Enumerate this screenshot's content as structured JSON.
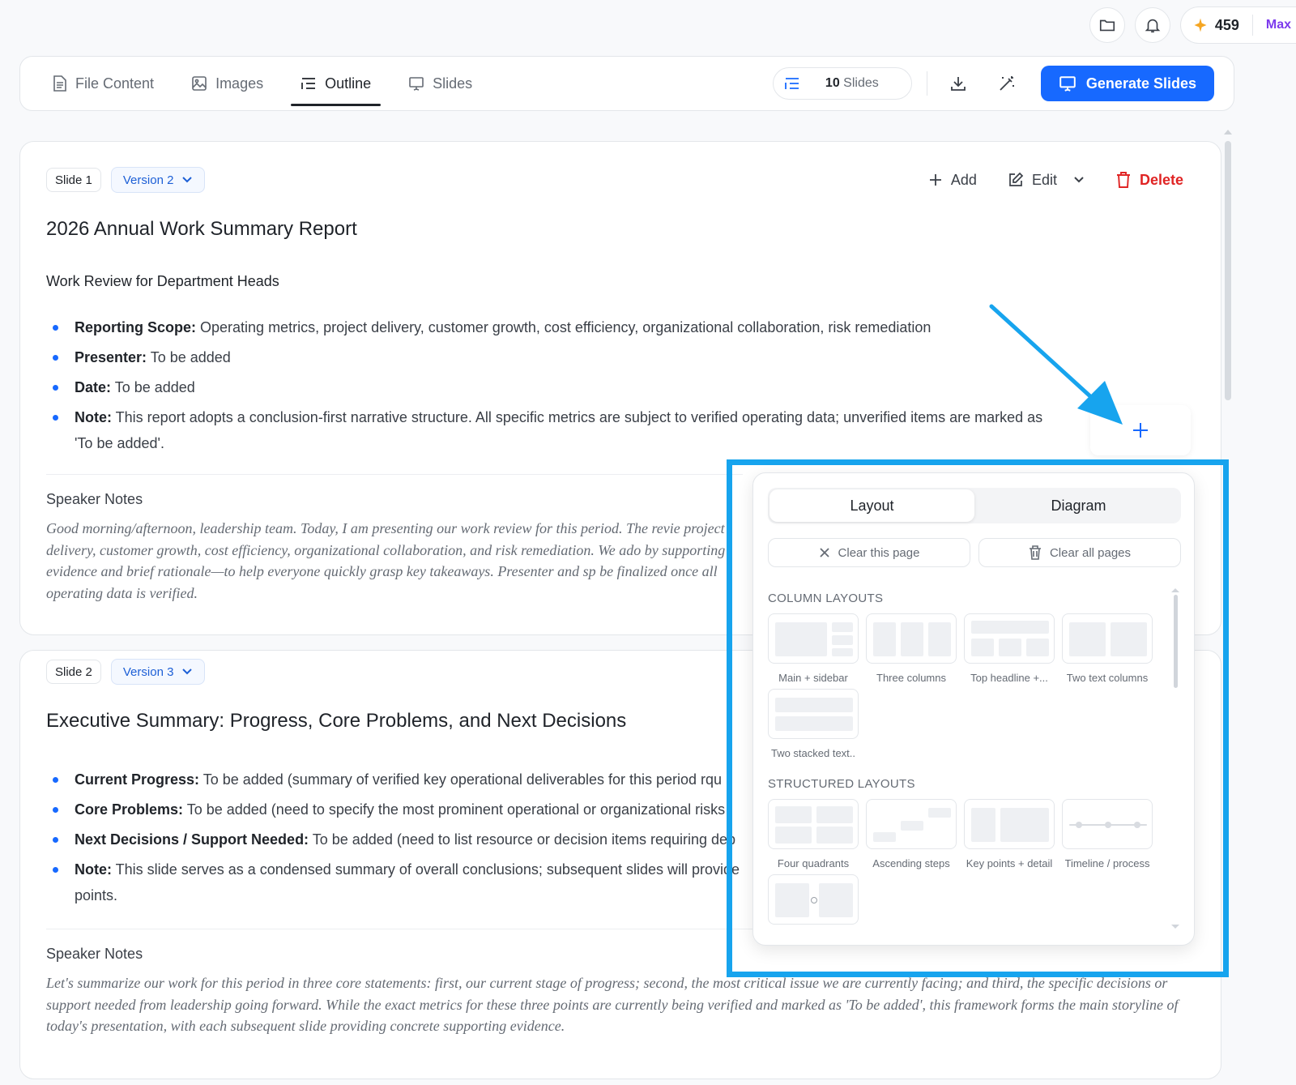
{
  "topbar": {
    "credits": "459",
    "plan": "Max"
  },
  "tabs": [
    {
      "label": "File Content",
      "icon": "file-icon"
    },
    {
      "label": "Images",
      "icon": "image-icon"
    },
    {
      "label": "Outline",
      "icon": "outline-icon",
      "active": true
    },
    {
      "label": "Slides",
      "icon": "presentation-icon"
    }
  ],
  "toolbar": {
    "slides_count": "10",
    "slides_unit": "Slides",
    "generate_label": "Generate Slides"
  },
  "slide_actions": {
    "add": "Add",
    "edit": "Edit",
    "delete": "Delete"
  },
  "slides": [
    {
      "chip": "Slide 1",
      "version": "Version  2",
      "title": "2026 Annual Work Summary Report",
      "subtitle": "Work Review for Department Heads",
      "bullets": [
        {
          "label": "Reporting Scope:",
          "text": " Operating metrics, project delivery, customer growth, cost efficiency, organizational collaboration, risk remediation"
        },
        {
          "label": "Presenter:",
          "text": " To be added"
        },
        {
          "label": "Date:",
          "text": " To be added"
        },
        {
          "label": "Note:",
          "text": " This report adopts a conclusion-first narrative structure. All specific metrics are subject to verified operating data; unverified items are marked as 'To be added'."
        }
      ],
      "notes_heading": "Speaker Notes",
      "notes": "Good morning/afternoon, leadership team. Today, I am presenting our work review for this period. The revie project delivery, customer growth, cost efficiency, organizational collaboration, and risk remediation. We ado by supporting evidence and brief rationale—to help everyone quickly grasp key takeaways. Presenter and sp be finalized once all operating data is verified."
    },
    {
      "chip": "Slide 2",
      "version": "Version  3",
      "title": "Executive Summary: Progress, Core Problems, and Next Decisions",
      "bullets": [
        {
          "label": "Current Progress:",
          "text": " To be added (summary of verified key operational deliverables for this period rqu"
        },
        {
          "label": "Core Problems:",
          "text": " To be added (need to specify the most prominent operational or organizational risks"
        },
        {
          "label": "Next Decisions / Support Needed:",
          "text": " To be added (need to list resource or decision items requiring dep"
        },
        {
          "label": "Note:",
          "text": " This slide serves as a condensed summary of overall conclusions; subsequent slides will provide points."
        }
      ],
      "notes_heading": "Speaker Notes",
      "notes": "Let's summarize our work for this period in three core statements: first, our current stage of progress; second, the most critical issue we are currently facing; and third, the specific decisions or support needed from leadership going forward. While the exact metrics for these three points are currently being verified and marked as 'To be added', this framework forms the main storyline of today's presentation, with each subsequent slide providing concrete supporting evidence."
    }
  ],
  "add_button": "+",
  "popover": {
    "tabs": [
      "Layout",
      "Diagram"
    ],
    "clear_page": "Clear this page",
    "clear_all": "Clear all pages",
    "column_heading": "COLUMN LAYOUTS",
    "column_layouts": [
      "Main + sidebar",
      "Three columns",
      "Top headline +...",
      "Two text columns",
      "Two stacked text.."
    ],
    "structured_heading": "STRUCTURED LAYOUTS",
    "structured_layouts": [
      "Four quadrants",
      "Ascending steps",
      "Key points + detail",
      "Timeline / process",
      ""
    ]
  },
  "colors": {
    "accent": "#1769ff",
    "delete": "#e02424",
    "highlight": "#17a4ee",
    "plan": "#7c3aed"
  }
}
